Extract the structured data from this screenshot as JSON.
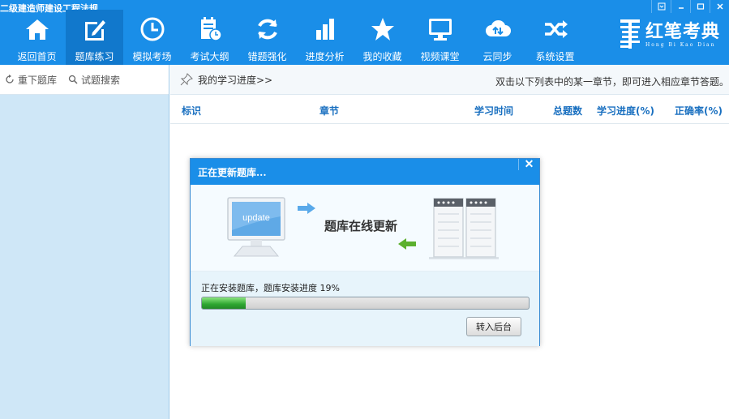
{
  "app": {
    "title": "二级建造师建设工程法规"
  },
  "window_controls": [
    {
      "name": "menu-icon"
    },
    {
      "name": "minimize-icon"
    },
    {
      "name": "maximize-icon"
    },
    {
      "name": "close-icon"
    }
  ],
  "nav": {
    "items": [
      {
        "label": "返回首页",
        "icon": "home-icon",
        "active": false
      },
      {
        "label": "题库练习",
        "icon": "edit-icon",
        "active": true
      },
      {
        "label": "模拟考场",
        "icon": "clock-icon",
        "active": false
      },
      {
        "label": "考试大纲",
        "icon": "calendar-icon",
        "active": false
      },
      {
        "label": "错题强化",
        "icon": "refresh-icon",
        "active": false
      },
      {
        "label": "进度分析",
        "icon": "bar-chart-icon",
        "active": false
      },
      {
        "label": "我的收藏",
        "icon": "star-icon",
        "active": false
      },
      {
        "label": "视频课堂",
        "icon": "monitor-icon",
        "active": false
      },
      {
        "label": "云同步",
        "icon": "cloud-sync-icon",
        "active": false
      },
      {
        "label": "系统设置",
        "icon": "shuffle-icon",
        "active": false
      }
    ]
  },
  "logo": {
    "cn": "红笔考典",
    "en": "Hong Bi Kao Dian"
  },
  "left_panel": {
    "reload_label": "重下题库",
    "search_label": "试题搜索"
  },
  "main": {
    "progress_link": "我的学习进度>>",
    "hint": "双击以下列表中的某一章节，即可进入相应章节答题。",
    "columns": [
      "标识",
      "章节",
      "学习时间",
      "总题数",
      "学习进度(%)",
      "正确率(%)"
    ]
  },
  "dialog": {
    "title": "正在更新题库...",
    "monitor_text": "update",
    "banner_text": "题库在线更新",
    "status_text": "正在安装题库，题库安装进度  19%",
    "progress": 0.135,
    "bg_button": "转入后台"
  },
  "colors": {
    "primary": "#1a8ee8",
    "active_nav": "#1178cc",
    "left_panel": "#cfe7f7",
    "progress_green": "#2ea632"
  }
}
